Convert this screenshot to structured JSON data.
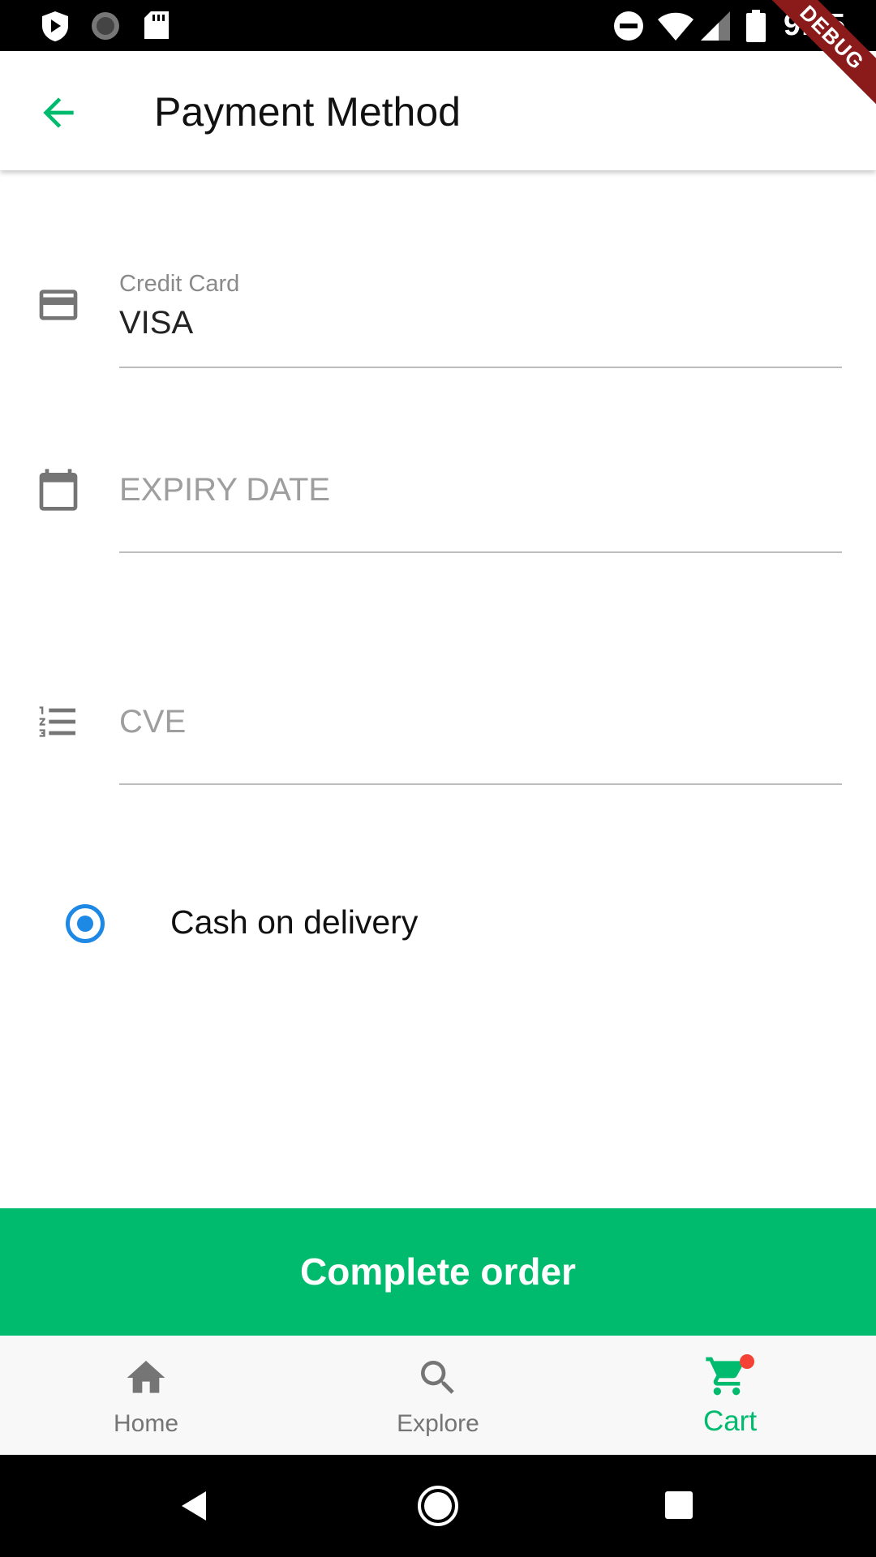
{
  "status_bar": {
    "time": "9:15"
  },
  "debug_banner": "DEBUG",
  "app_bar": {
    "title": "Payment Method"
  },
  "form": {
    "credit_card": {
      "label": "Credit Card",
      "value": "VISA"
    },
    "expiry_date": {
      "placeholder": "EXPIRY DATE"
    },
    "cve": {
      "placeholder": "CVE"
    }
  },
  "payment_option": {
    "label": "Cash on delivery",
    "selected": true
  },
  "complete_button": {
    "label": "Complete order"
  },
  "bottom_nav": {
    "items": [
      {
        "label": "Home",
        "icon": "home-icon",
        "active": false
      },
      {
        "label": "Explore",
        "icon": "search-icon",
        "active": false
      },
      {
        "label": "Cart",
        "icon": "cart-icon",
        "active": true
      }
    ]
  },
  "colors": {
    "accent": "#00bb6e",
    "radio": "#1e88e5",
    "badge": "#f44336",
    "icon_gray": "#757575"
  }
}
